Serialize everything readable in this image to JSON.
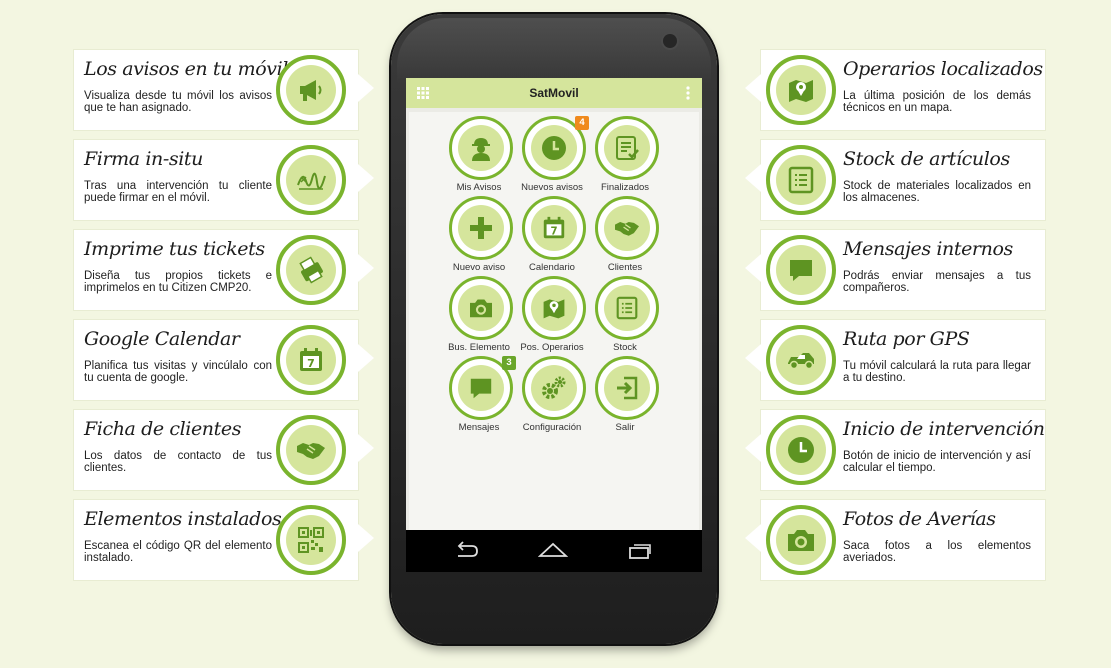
{
  "features_left": [
    {
      "title": "Los avisos en tu móvil",
      "desc": "Visualiza desde tu móvil los avisos que te han asignado.",
      "icon": "megaphone-icon"
    },
    {
      "title": "Firma in-situ",
      "desc": "Tras una intervención tu cliente puede firmar en el móvil.",
      "icon": "signature-icon"
    },
    {
      "title": "Imprime tus tickets",
      "desc": "Diseña tus propios tickets e imprimelos en tu Citizen CMP20.",
      "icon": "printer-icon"
    },
    {
      "title": "Google Calendar",
      "desc": "Planifica tus visitas y vincúlalo con tu cuenta de google.",
      "icon": "calendar-icon"
    },
    {
      "title": "Ficha de clientes",
      "desc": "Los datos de contacto de tus clientes.",
      "icon": "handshake-icon"
    },
    {
      "title": "Elementos instalados",
      "desc": "Escanea el código QR del elemento instalado.",
      "icon": "qr-code-icon"
    }
  ],
  "features_right": [
    {
      "title": "Operarios localizados",
      "desc": "La última posición de los demás técnicos en un mapa.",
      "icon": "map-pin-icon"
    },
    {
      "title": "Stock de artículos",
      "desc": "Stock de materiales localizados en los almacenes.",
      "icon": "list-icon"
    },
    {
      "title": "Mensajes internos",
      "desc": "Podrás enviar mensajes a tus compañeros.",
      "icon": "chat-icon"
    },
    {
      "title": "Ruta por GPS",
      "desc": "Tu móvil calculará la ruta para llegar a tu destino.",
      "icon": "car-icon"
    },
    {
      "title": "Inicio de intervención",
      "desc": "Botón de inicio de intervención y así calcular el tiempo.",
      "icon": "clock-icon"
    },
    {
      "title": "Fotos de Averías",
      "desc": "Saca fotos a los elementos averiados.",
      "icon": "camera-icon"
    }
  ],
  "app": {
    "title": "SatMovil",
    "tiles": [
      {
        "label": "Mis Avisos",
        "icon": "worker-icon",
        "badge": ""
      },
      {
        "label": "Nuevos avisos",
        "icon": "clock-icon",
        "badge": "4",
        "badge_color": "#f08a1c"
      },
      {
        "label": "Finalizados",
        "icon": "checklist-icon",
        "badge": ""
      },
      {
        "label": "Nuevo aviso",
        "icon": "plus-icon",
        "badge": ""
      },
      {
        "label": "Calendario",
        "icon": "calendar-icon",
        "badge": ""
      },
      {
        "label": "Clientes",
        "icon": "handshake-icon",
        "badge": ""
      },
      {
        "label": "Bus. Elemento",
        "icon": "camera-icon",
        "badge": ""
      },
      {
        "label": "Pos. Operarios",
        "icon": "map-pin-icon",
        "badge": ""
      },
      {
        "label": "Stock",
        "icon": "list-icon",
        "badge": ""
      },
      {
        "label": "Mensajes",
        "icon": "chat-icon",
        "badge": "3",
        "badge_color": "#6aa62a"
      },
      {
        "label": "Configuración",
        "icon": "gears-icon",
        "badge": ""
      },
      {
        "label": "Salir",
        "icon": "exit-icon",
        "badge": ""
      }
    ]
  },
  "colors": {
    "accent": "#7ab42d",
    "icon_fill": "#5e9422",
    "icon_bg": "#d5e59c",
    "page_bg": "#f3f6e1"
  }
}
